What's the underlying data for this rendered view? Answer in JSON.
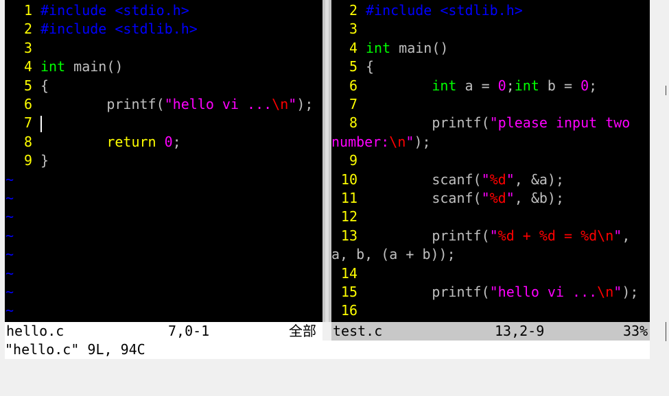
{
  "left_pane": {
    "lines": [
      {
        "num": "1",
        "segments": [
          {
            "t": "#include <stdio.h>",
            "c": "c-pre"
          }
        ]
      },
      {
        "num": "2",
        "segments": [
          {
            "t": "#include <stdlib.h>",
            "c": "c-pre"
          }
        ]
      },
      {
        "num": "3",
        "segments": []
      },
      {
        "num": "4",
        "segments": [
          {
            "t": "int",
            "c": "c-type"
          },
          {
            "t": " main()",
            "c": "c-fn"
          }
        ]
      },
      {
        "num": "5",
        "segments": [
          {
            "t": "{",
            "c": "c-fn"
          }
        ]
      },
      {
        "num": "6",
        "segments": [
          {
            "t": "        printf(",
            "c": "c-fn"
          },
          {
            "t": "\"hello vi ...",
            "c": "c-str"
          },
          {
            "t": "\\n",
            "c": "c-esc"
          },
          {
            "t": "\"",
            "c": "c-str"
          },
          {
            "t": ");",
            "c": "c-fn"
          }
        ]
      },
      {
        "num": "7",
        "segments": [],
        "cursor": true
      },
      {
        "num": "8",
        "segments": [
          {
            "t": "        ",
            "c": "c-fn"
          },
          {
            "t": "return",
            "c": "c-kw"
          },
          {
            "t": " ",
            "c": "c-fn"
          },
          {
            "t": "0",
            "c": "c-num"
          },
          {
            "t": ";",
            "c": "c-fn"
          }
        ]
      },
      {
        "num": "9",
        "segments": [
          {
            "t": "}",
            "c": "c-fn"
          }
        ]
      }
    ],
    "tildes": [
      "~",
      "~",
      "~",
      "~",
      "~",
      "~",
      "~",
      "~"
    ]
  },
  "right_pane": {
    "lines": [
      {
        "num": "2",
        "segments": [
          {
            "t": "#include <stdlib.h>",
            "c": "c-pre"
          }
        ]
      },
      {
        "num": "3",
        "segments": []
      },
      {
        "num": "4",
        "segments": [
          {
            "t": "int",
            "c": "c-type"
          },
          {
            "t": " main()",
            "c": "c-fn"
          }
        ]
      },
      {
        "num": "5",
        "segments": [
          {
            "t": "{",
            "c": "c-fn"
          }
        ]
      },
      {
        "num": "6",
        "segments": [
          {
            "t": "        ",
            "c": "c-fn"
          },
          {
            "t": "int",
            "c": "c-type"
          },
          {
            "t": " a = ",
            "c": "c-fn"
          },
          {
            "t": "0",
            "c": "c-num"
          },
          {
            "t": ";",
            "c": "c-fn"
          },
          {
            "t": "int",
            "c": "c-type"
          },
          {
            "t": " b = ",
            "c": "c-fn"
          },
          {
            "t": "0",
            "c": "c-num"
          },
          {
            "t": ";",
            "c": "c-fn"
          }
        ]
      },
      {
        "num": "7",
        "segments": []
      },
      {
        "num": "8",
        "segments": [
          {
            "t": "        printf(",
            "c": "c-fn"
          },
          {
            "t": "\"please input two",
            "c": "c-str"
          }
        ]
      },
      {
        "num": "",
        "segments": [
          {
            "t": "number:",
            "c": "c-str"
          },
          {
            "t": "\\n",
            "c": "c-esc"
          },
          {
            "t": "\"",
            "c": "c-str"
          },
          {
            "t": ");",
            "c": "c-fn"
          }
        ]
      },
      {
        "num": "9",
        "segments": []
      },
      {
        "num": "10",
        "segments": [
          {
            "t": "        scanf(",
            "c": "c-fn"
          },
          {
            "t": "\"",
            "c": "c-str"
          },
          {
            "t": "%d",
            "c": "c-esc"
          },
          {
            "t": "\"",
            "c": "c-str"
          },
          {
            "t": ", &a);",
            "c": "c-fn"
          }
        ]
      },
      {
        "num": "11",
        "segments": [
          {
            "t": "        scanf(",
            "c": "c-fn"
          },
          {
            "t": "\"",
            "c": "c-str"
          },
          {
            "t": "%d",
            "c": "c-esc"
          },
          {
            "t": "\"",
            "c": "c-str"
          },
          {
            "t": ", &b);",
            "c": "c-fn"
          }
        ]
      },
      {
        "num": "12",
        "segments": []
      },
      {
        "num": "13",
        "segments": [
          {
            "t": "        printf(",
            "c": "c-fn"
          },
          {
            "t": "\"",
            "c": "c-str"
          },
          {
            "t": "%d + %d = %d",
            "c": "c-esc"
          },
          {
            "t": "\\n",
            "c": "c-esc"
          },
          {
            "t": "\"",
            "c": "c-str"
          },
          {
            "t": ",",
            "c": "c-fn"
          }
        ]
      },
      {
        "num": "",
        "segments": [
          {
            "t": "a, b, (a + b));",
            "c": "c-fn"
          }
        ]
      },
      {
        "num": "14",
        "segments": []
      },
      {
        "num": "15",
        "segments": [
          {
            "t": "        printf(",
            "c": "c-fn"
          },
          {
            "t": "\"hello vi ...",
            "c": "c-str"
          },
          {
            "t": "\\n",
            "c": "c-esc"
          },
          {
            "t": "\"",
            "c": "c-str"
          },
          {
            "t": ");",
            "c": "c-fn"
          }
        ]
      },
      {
        "num": "16",
        "segments": []
      }
    ]
  },
  "status_left": {
    "file": "hello.c",
    "pos": "7,0-1",
    "scroll": "全部"
  },
  "status_right": {
    "file": "test.c",
    "pos": "13,2-9",
    "scroll": "33%"
  },
  "cmdline": "\"hello.c\" 9L, 94C",
  "colors": {
    "pre": "#0000ff",
    "str": "#ff00ff",
    "esc": "#ff0000",
    "type": "#00ff00",
    "kw": "#ffff00",
    "linenum": "#ffff00",
    "tilde": "#0000ff"
  }
}
